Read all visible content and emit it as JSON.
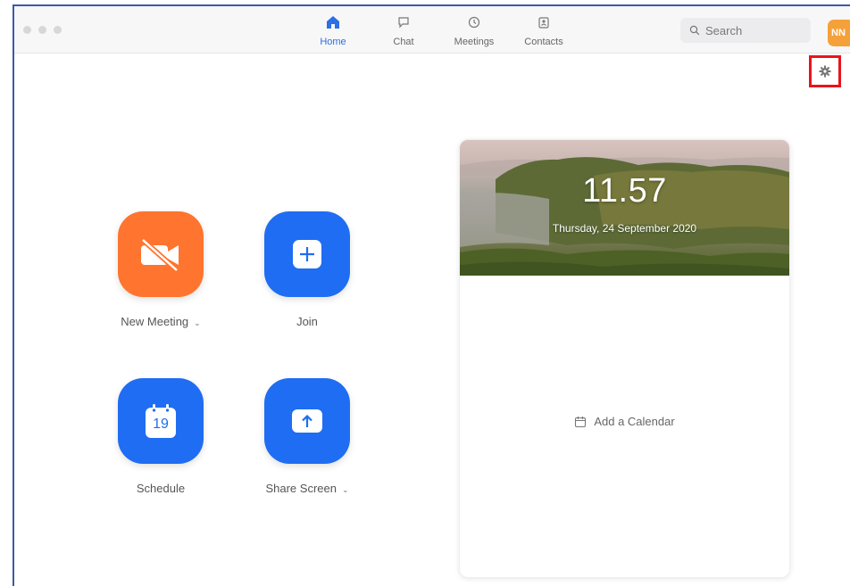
{
  "nav": {
    "tabs": [
      {
        "label": "Home",
        "icon": "home-icon",
        "active": true
      },
      {
        "label": "Chat",
        "icon": "chat-icon",
        "active": false
      },
      {
        "label": "Meetings",
        "icon": "clock-icon",
        "active": false
      },
      {
        "label": "Contacts",
        "icon": "contacts-icon",
        "active": false
      }
    ]
  },
  "search": {
    "placeholder": "Search"
  },
  "user": {
    "initials": "NN"
  },
  "settings": {
    "icon": "gear-icon",
    "highlight_color": "#e8141b"
  },
  "actions": [
    {
      "label": "New Meeting",
      "icon": "video-off-icon",
      "color": "#ff742e",
      "has_dropdown": true
    },
    {
      "label": "Join",
      "icon": "plus-icon",
      "color": "#1f6df2",
      "has_dropdown": false
    },
    {
      "label": "Schedule",
      "icon": "calendar-icon",
      "calendar_day": "19",
      "color": "#1f6df2",
      "has_dropdown": false
    },
    {
      "label": "Share Screen",
      "icon": "share-screen-icon",
      "color": "#1f6df2",
      "has_dropdown": true
    }
  ],
  "calendar_card": {
    "time": "11.57",
    "date": "Thursday, 24 September 2020",
    "add_calendar_label": "Add a Calendar"
  },
  "colors": {
    "accent": "#2d6fe6",
    "window_border": "#3b5aa8",
    "avatar": "#f5a13a"
  }
}
